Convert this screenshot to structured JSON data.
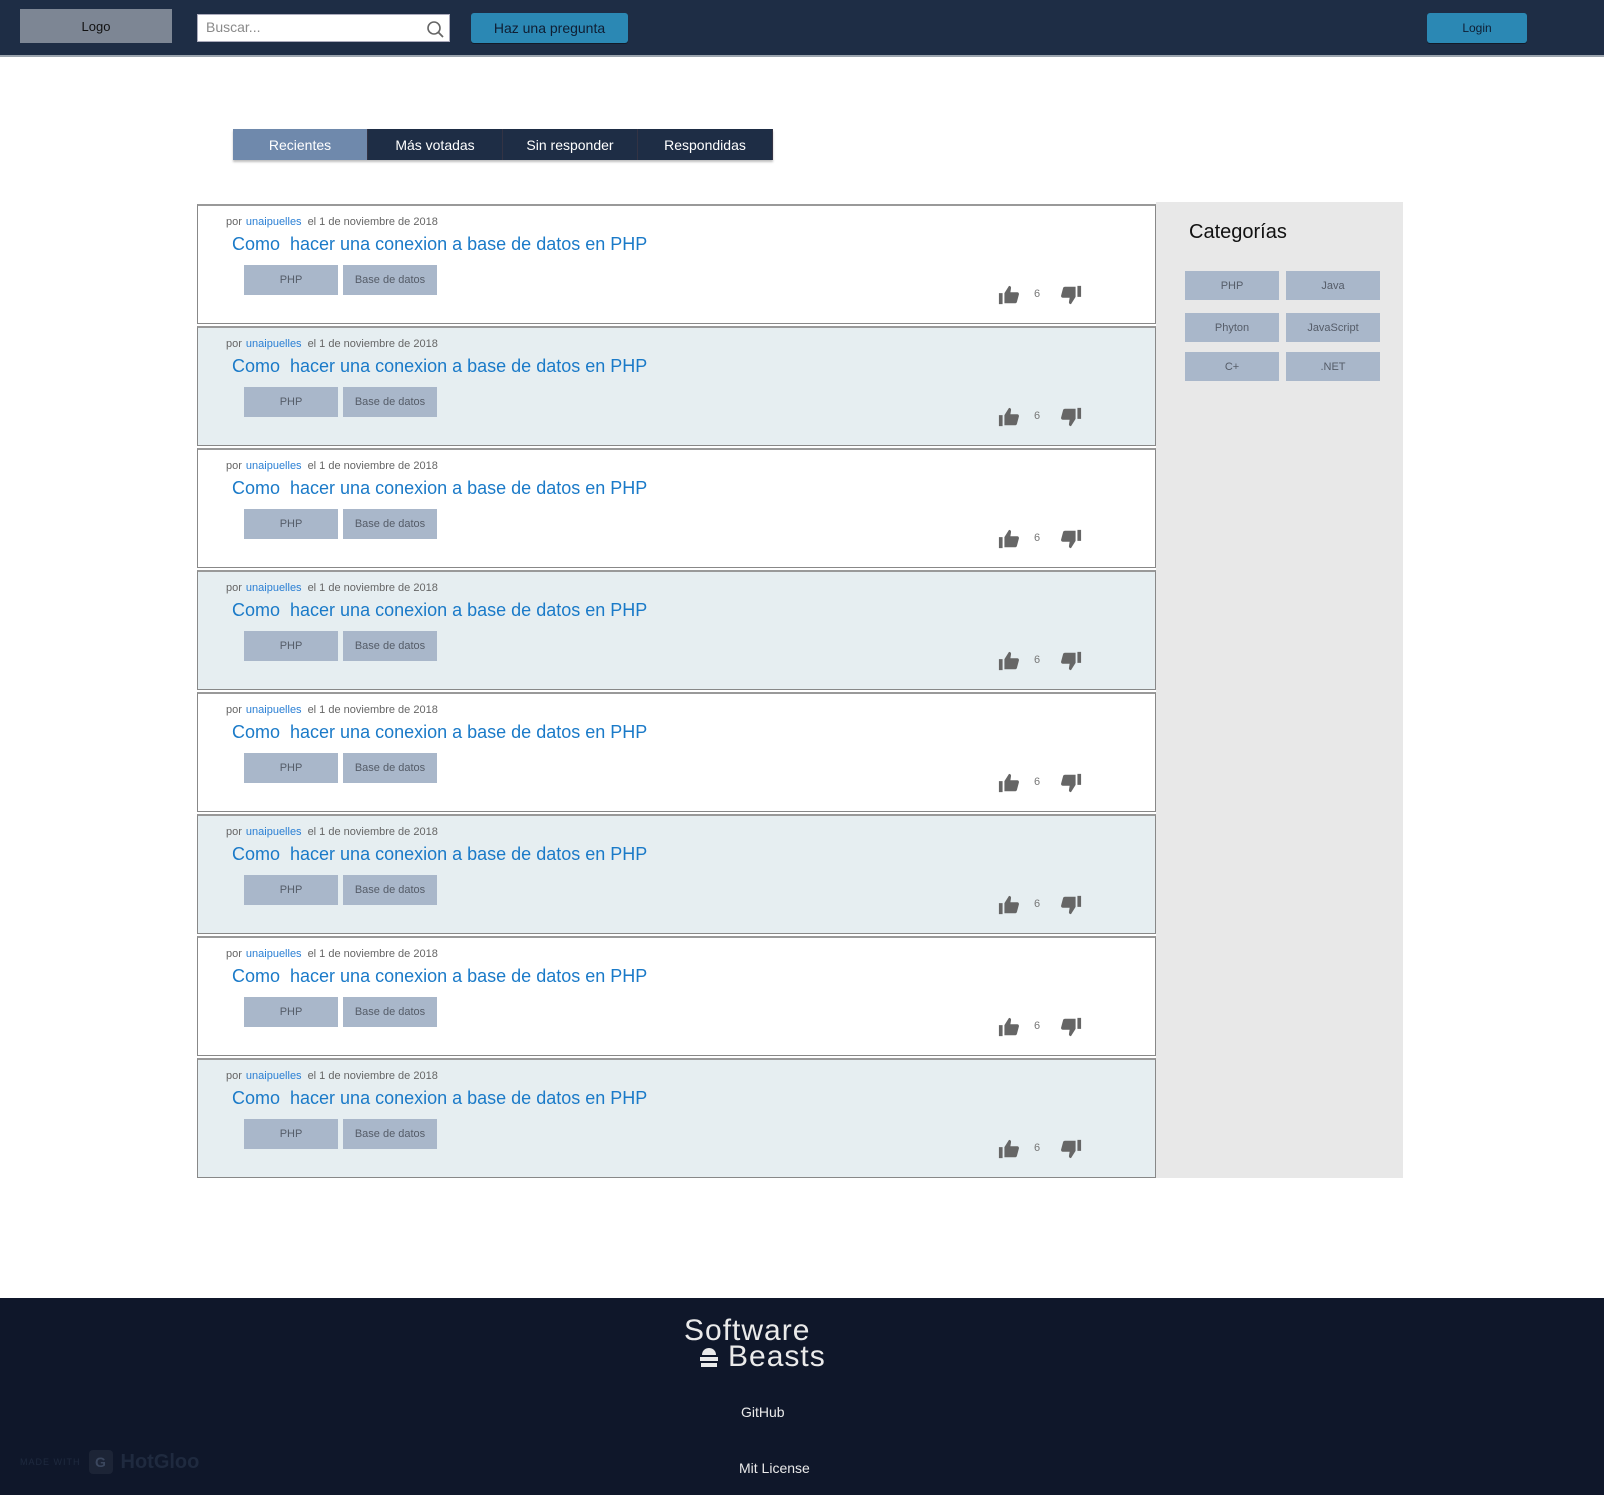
{
  "header": {
    "logo": "Logo",
    "search_placeholder": "Buscar...",
    "ask_button": "Haz una pregunta",
    "login_button": "Login"
  },
  "tabs": [
    "Recientes",
    "Más votadas",
    "Sin responder",
    "Respondidas"
  ],
  "questions": [
    {
      "by": "por",
      "author": "unaipuelles",
      "date": "el 1 de noviembre de 2018",
      "title": "Como  hacer una conexion a base de datos en PHP",
      "tags": [
        "PHP",
        "Base de datos"
      ],
      "votes": "6"
    },
    {
      "by": "por",
      "author": "unaipuelles",
      "date": "el 1 de noviembre de 2018",
      "title": "Como  hacer una conexion a base de datos en PHP",
      "tags": [
        "PHP",
        "Base de datos"
      ],
      "votes": "6"
    },
    {
      "by": "por",
      "author": "unaipuelles",
      "date": "el 1 de noviembre de 2018",
      "title": "Como  hacer una conexion a base de datos en PHP",
      "tags": [
        "PHP",
        "Base de datos"
      ],
      "votes": "6"
    },
    {
      "by": "por",
      "author": "unaipuelles",
      "date": "el 1 de noviembre de 2018",
      "title": "Como  hacer una conexion a base de datos en PHP",
      "tags": [
        "PHP",
        "Base de datos"
      ],
      "votes": "6"
    },
    {
      "by": "por",
      "author": "unaipuelles",
      "date": "el 1 de noviembre de 2018",
      "title": "Como  hacer una conexion a base de datos en PHP",
      "tags": [
        "PHP",
        "Base de datos"
      ],
      "votes": "6"
    },
    {
      "by": "por",
      "author": "unaipuelles",
      "date": "el 1 de noviembre de 2018",
      "title": "Como  hacer una conexion a base de datos en PHP",
      "tags": [
        "PHP",
        "Base de datos"
      ],
      "votes": "6"
    },
    {
      "by": "por",
      "author": "unaipuelles",
      "date": "el 1 de noviembre de 2018",
      "title": "Como  hacer una conexion a base de datos en PHP",
      "tags": [
        "PHP",
        "Base de datos"
      ],
      "votes": "6"
    },
    {
      "by": "por",
      "author": "unaipuelles",
      "date": "el 1 de noviembre de 2018",
      "title": "Como  hacer una conexion a base de datos en PHP",
      "tags": [
        "PHP",
        "Base de datos"
      ],
      "votes": "6"
    }
  ],
  "sidebar": {
    "title": "Categorías",
    "categories": [
      "PHP",
      "Java",
      "Phyton",
      "JavaScript",
      "C+",
      ".NET"
    ]
  },
  "footer": {
    "brand_line1": "Software",
    "brand_line2": "Beasts",
    "links": [
      "GitHub",
      "Mit License"
    ],
    "made_with": "MADE WITH",
    "made_with_brand": "HotGloo"
  },
  "colors": {
    "header_bg": "#1e2d45",
    "accent": "#2b88b4",
    "link": "#1a7ac8",
    "tag_bg": "#a9b7ca",
    "alt_row": "#e6eef1",
    "footer_bg": "#0f172a"
  },
  "icons": [
    "search-icon",
    "thumbs-up-icon",
    "thumbs-down-icon",
    "hat-icon"
  ]
}
